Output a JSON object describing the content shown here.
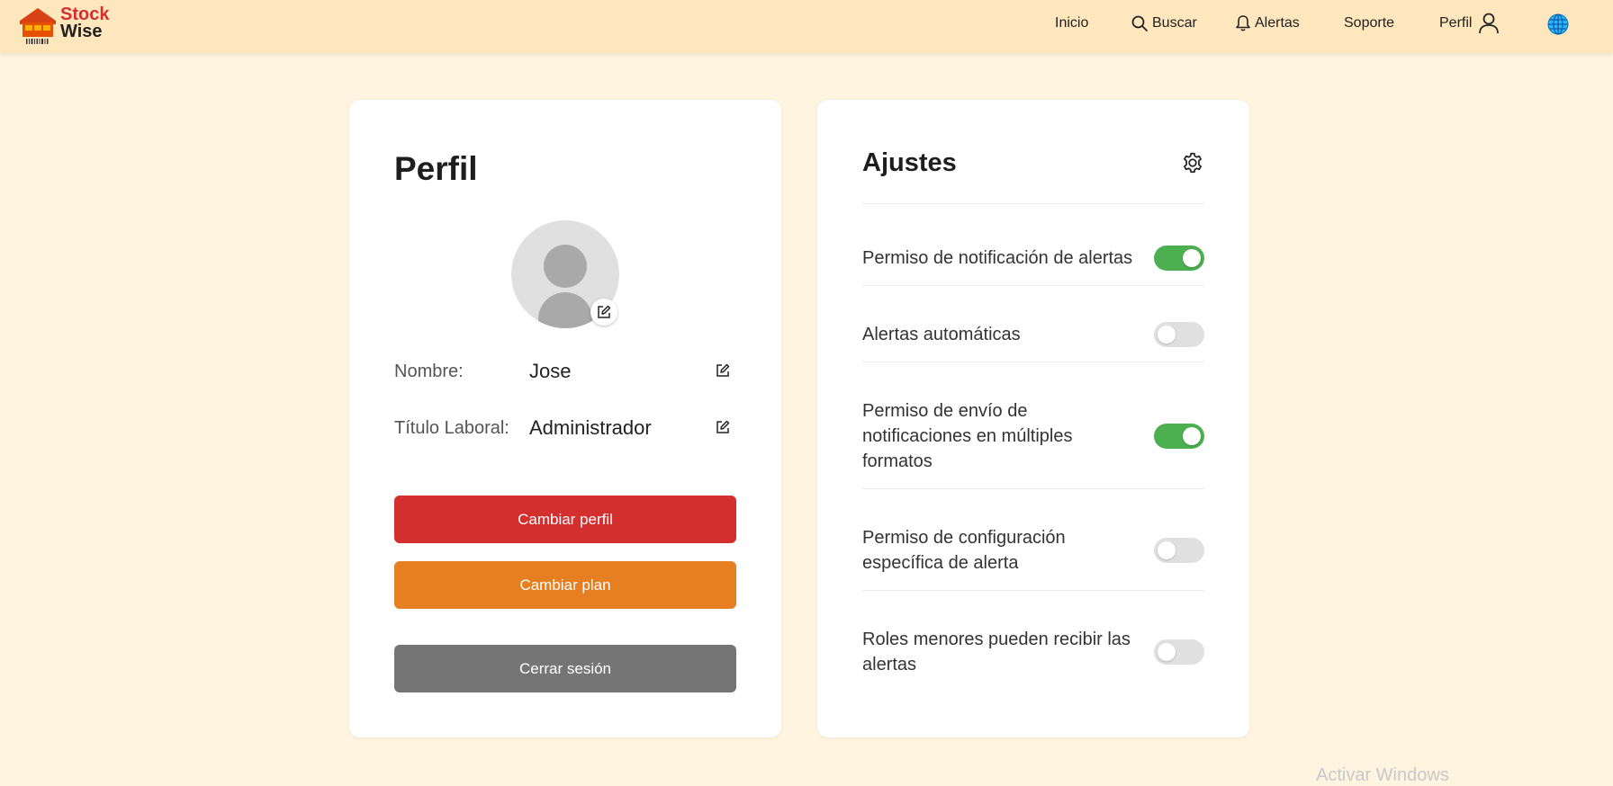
{
  "header": {
    "logo": {
      "line1": "Stock",
      "line2": "Wise"
    },
    "nav": [
      {
        "label": "Inicio",
        "icon": ""
      },
      {
        "label": "Buscar",
        "icon": "search-icon"
      },
      {
        "label": "Alertas",
        "icon": "bell-icon"
      },
      {
        "label": "Soporte",
        "icon": ""
      },
      {
        "label": "Perfil",
        "icon": "user-icon"
      }
    ],
    "language_icon": "globe-icon"
  },
  "profile": {
    "title": "Perfil",
    "fields": [
      {
        "label": "Nombre:",
        "value": "Jose"
      },
      {
        "label": "Título Laboral:",
        "value": "Administrador"
      }
    ],
    "buttons": {
      "change_profile": "Cambiar perfil",
      "change_plan": "Cambiar plan",
      "logout": "Cerrar sesión"
    },
    "colors": {
      "red": "#d32f2f",
      "orange": "#e67e22",
      "gray": "#757575"
    }
  },
  "settings": {
    "title": "Ajustes",
    "items": [
      {
        "label": "Permiso de notificación de alertas",
        "enabled": true
      },
      {
        "label": "Alertas automáticas",
        "enabled": false
      },
      {
        "label": "Permiso de envío de notificaciones en múltiples formatos",
        "enabled": true
      },
      {
        "label": "Permiso de configuración específica de alerta",
        "enabled": false
      },
      {
        "label": "Roles menores pueden recibir las alertas",
        "enabled": false
      }
    ],
    "colors": {
      "toggle_on": "#4caf50",
      "toggle_off": "#e0e0e0"
    }
  },
  "watermark": "Activar Windows"
}
